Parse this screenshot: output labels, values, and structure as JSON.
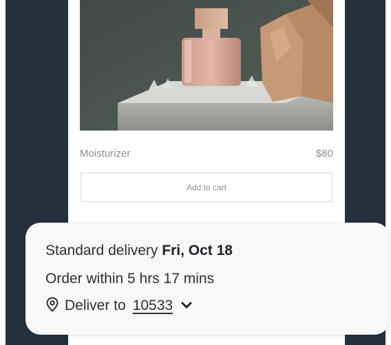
{
  "product": {
    "name": "Moisturizer",
    "price": "$80",
    "add_to_cart_label": "Add to cart"
  },
  "delivery": {
    "standard_prefix": "Standard delivery",
    "date": "Fri, Oct 18",
    "order_within": "Order within 5 hrs 17 mins",
    "deliver_to_label": "Deliver to",
    "zip": "10533"
  },
  "icons": {
    "location": "map-pin-icon",
    "dropdown": "chevron-down-icon"
  },
  "colors": {
    "background": "#25303d",
    "panel": "#f8f8f8",
    "text": "#2b2f36"
  }
}
